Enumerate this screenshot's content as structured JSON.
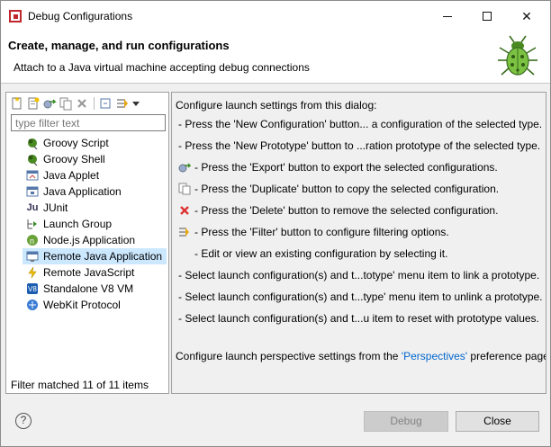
{
  "window": {
    "title": "Debug Configurations",
    "controls": {
      "minimize": "",
      "maximize": "",
      "close": "✕"
    }
  },
  "banner": {
    "title": "Create, manage, and run configurations",
    "message": "Attach to a Java virtual machine accepting debug connections",
    "icon": "bug-icon"
  },
  "left": {
    "toolbar_icons": [
      "new-configuration-icon",
      "new-prototype-icon",
      "export-icon",
      "duplicate-icon",
      "delete-icon",
      "collapse-all-icon",
      "filter-icon",
      "dropdown-icon"
    ],
    "filter_placeholder": "type filter text",
    "items": [
      {
        "label": "Groovy Script",
        "icon": "groovy-icon"
      },
      {
        "label": "Groovy Shell",
        "icon": "groovy-icon"
      },
      {
        "label": "Java Applet",
        "icon": "java-applet-icon"
      },
      {
        "label": "Java Application",
        "icon": "java-application-icon"
      },
      {
        "label": "JUnit",
        "icon": "junit-icon"
      },
      {
        "label": "Launch Group",
        "icon": "launch-group-icon"
      },
      {
        "label": "Node.js Application",
        "icon": "nodejs-icon"
      },
      {
        "label": "Remote Java Application",
        "icon": "remote-java-icon",
        "selected": true
      },
      {
        "label": "Remote JavaScript",
        "icon": "remote-javascript-icon"
      },
      {
        "label": "Standalone V8 VM",
        "icon": "v8-icon"
      },
      {
        "label": "WebKit Protocol",
        "icon": "webkit-icon"
      }
    ],
    "status": "Filter matched 11 of 11 items"
  },
  "right": {
    "intro": "Configure launch settings from this dialog:",
    "lines": [
      "- Press the 'New Configuration' button... a configuration of the selected type.",
      "- Press the 'New Prototype' button to ...ration prototype of the selected type.",
      "- Press the 'Export' button to export the selected configurations.",
      "- Press the 'Duplicate' button to copy the selected configuration.",
      "- Press the 'Delete' button to remove the selected configuration.",
      "- Press the 'Filter' button to configure filtering options.",
      "- Edit or view an existing configuration by selecting it.",
      "- Select launch configuration(s) and t...totype' menu item to link a prototype.",
      "- Select launch configuration(s) and t...type' menu item to unlink a prototype.",
      "- Select launch configuration(s) and t...u item to reset with prototype values."
    ],
    "perspective_prefix": "Configure launch perspective settings from the ",
    "perspective_link": "'Perspectives'",
    "perspective_suffix": " preference page."
  },
  "buttons": {
    "help": "?",
    "debug": "Debug",
    "close": "Close"
  }
}
